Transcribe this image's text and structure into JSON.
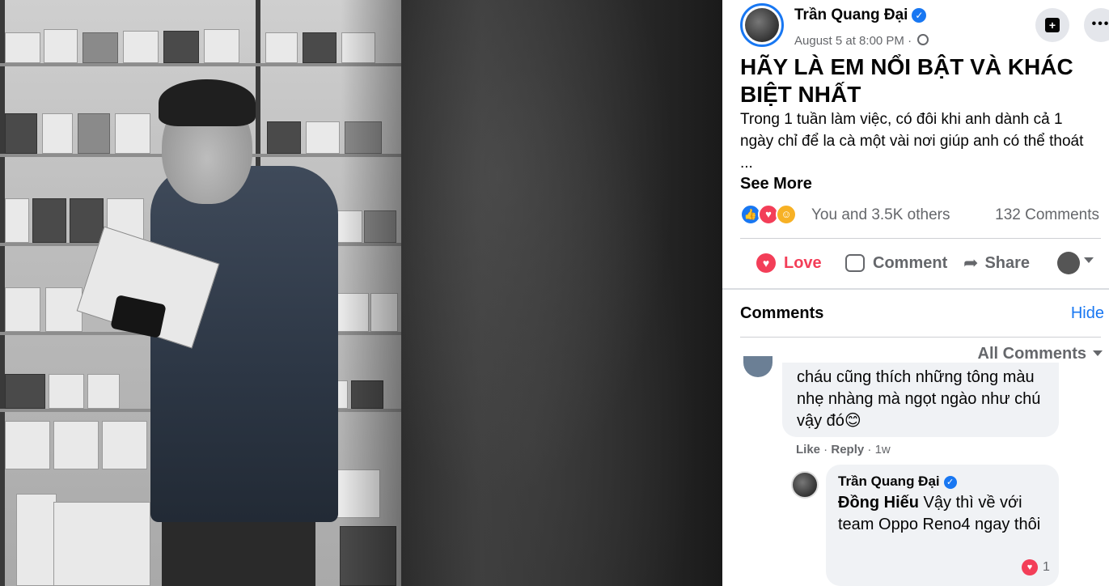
{
  "post": {
    "author": "Trần Quang Đại",
    "timestamp": "August 5 at 8:00 PM",
    "title": "HÃY LÀ EM NỔI BẬT VÀ KHÁC BIỆT NHẤT",
    "body": "Trong 1 tuần làm việc, có đôi khi anh dành cả 1 ngày chỉ để la cà một vài nơi giúp anh có thể thoát ...",
    "see_more": "See More"
  },
  "reactions": {
    "summary": "You and 3.5K others",
    "comment_count": "132 Comments",
    "icons": [
      "like-icon",
      "love-icon",
      "care-icon"
    ]
  },
  "actions": {
    "love": "Love",
    "comment": "Comment",
    "share": "Share"
  },
  "comments": {
    "heading": "Comments",
    "hide": "Hide",
    "filter": "All Comments",
    "items": [
      {
        "text": "cháu cũng thích những tông màu nhẹ nhàng mà ngọt ngào như chú vậy đó😊",
        "like": "Like",
        "reply": "Reply",
        "age": "1w"
      }
    ],
    "reply": {
      "author": "Trần Quang Đại",
      "tag": "Đồng Hiếu",
      "text": " Vậy thì về với team Oppo Reno4 ngay thôi",
      "reaction_count": "1"
    }
  },
  "colors": {
    "accent": "#1877f2",
    "love": "#f33e58",
    "muted": "#65676b",
    "bubble": "#f0f2f5"
  }
}
